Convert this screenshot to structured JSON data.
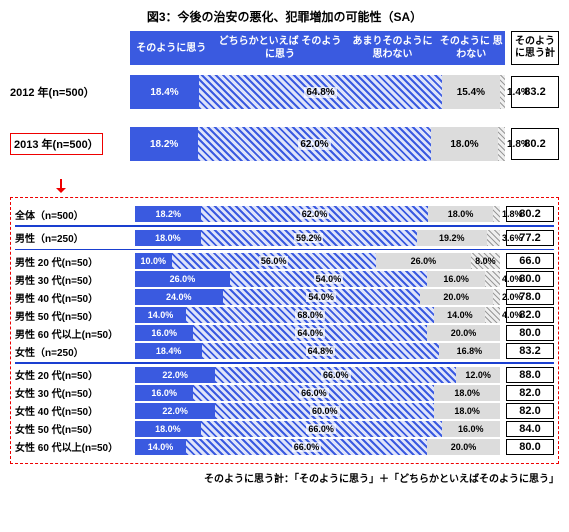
{
  "title": "図3：今後の治安の悪化、犯罪増加の可能性（SA）",
  "legend": [
    "そのように思う",
    "どちらかといえば\nそのように思う",
    "あまりそのように\n思わない",
    "そのように\n思わない"
  ],
  "sum_label": "そのよう\nに思う計",
  "footnote": "そのように思う計：「そのように思う」＋「どちらかといえばそのように思う」",
  "chart_data": {
    "type": "bar",
    "stacked": true,
    "xlabel": "",
    "ylabel": "%",
    "ylim": [
      0,
      100
    ],
    "categories": [
      "そのように思う",
      "どちらかといえばそのように思う",
      "あまりそのように思わない",
      "そのように思わない"
    ],
    "top": [
      {
        "label": "2012 年(n=500）",
        "values": [
          18.4,
          64.8,
          15.4,
          1.4
        ],
        "sum": 83.2
      },
      {
        "label": "2013 年(n=500）",
        "values": [
          18.2,
          62.0,
          18.0,
          1.8
        ],
        "sum": 80.2,
        "highlight": true
      }
    ],
    "detail": [
      {
        "label": "全体（n=500）",
        "values": [
          18.2,
          62.0,
          18.0,
          1.8
        ],
        "sum": 80.2
      },
      {
        "label": "男性（n=250）",
        "values": [
          18.0,
          59.2,
          19.2,
          3.6
        ],
        "sum": 77.2
      },
      {
        "label": "男性 20 代(n=50）",
        "values": [
          10.0,
          56.0,
          26.0,
          8.0
        ],
        "sum": 66.0
      },
      {
        "label": "男性 30 代(n=50）",
        "values": [
          26.0,
          54.0,
          16.0,
          4.0
        ],
        "sum": 80.0
      },
      {
        "label": "男性 40 代(n=50）",
        "values": [
          24.0,
          54.0,
          20.0,
          2.0
        ],
        "sum": 78.0
      },
      {
        "label": "男性 50 代(n=50）",
        "values": [
          14.0,
          68.0,
          14.0,
          4.0
        ],
        "sum": 82.0
      },
      {
        "label": "男性 60 代以上(n=50）",
        "values": [
          16.0,
          64.0,
          20.0,
          0.0
        ],
        "sum": 80.0
      },
      {
        "label": "女性（n=250）",
        "values": [
          18.4,
          64.8,
          16.8,
          0.0
        ],
        "sum": 83.2
      },
      {
        "label": "女性 20 代(n=50）",
        "values": [
          22.0,
          66.0,
          12.0,
          0.0
        ],
        "sum": 88.0
      },
      {
        "label": "女性 30 代(n=50）",
        "values": [
          16.0,
          66.0,
          18.0,
          0.0
        ],
        "sum": 82.0
      },
      {
        "label": "女性 40 代(n=50）",
        "values": [
          22.0,
          60.0,
          18.0,
          0.0
        ],
        "sum": 82.0
      },
      {
        "label": "女性 50 代(n=50）",
        "values": [
          18.0,
          66.0,
          16.0,
          0.0
        ],
        "sum": 84.0
      },
      {
        "label": "女性 60 代以上(n=50）",
        "values": [
          14.0,
          66.0,
          20.0,
          0.0
        ],
        "sum": 80.0
      }
    ],
    "dividers_after": [
      0,
      1,
      7
    ]
  }
}
